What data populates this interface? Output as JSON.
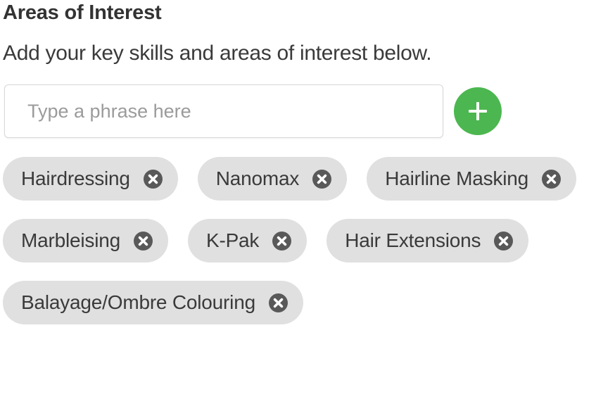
{
  "section": {
    "title": "Areas of Interest",
    "subtitle": "Add your key skills and areas of interest below."
  },
  "entry": {
    "input_value": "",
    "input_placeholder": "Type a phrase here",
    "add_button_label": "+",
    "add_button_color": "#4cb750"
  },
  "tags": [
    {
      "label": "Hairdressing",
      "remove_label": "x"
    },
    {
      "label": "Nanomax",
      "remove_label": "x"
    },
    {
      "label": "Hairline Masking",
      "remove_label": "x"
    },
    {
      "label": "Marbleising",
      "remove_label": "x"
    },
    {
      "label": "K-Pak",
      "remove_label": "x"
    },
    {
      "label": "Hair Extensions",
      "remove_label": "x"
    },
    {
      "label": "Balayage/Ombre Colouring",
      "remove_label": "x"
    }
  ],
  "colors": {
    "tag_background": "#e0e0e0",
    "tag_text": "#3a3a3a",
    "remove_icon_background": "#595959",
    "accent_green": "#4cb750",
    "placeholder_text": "#9b9b9b"
  }
}
